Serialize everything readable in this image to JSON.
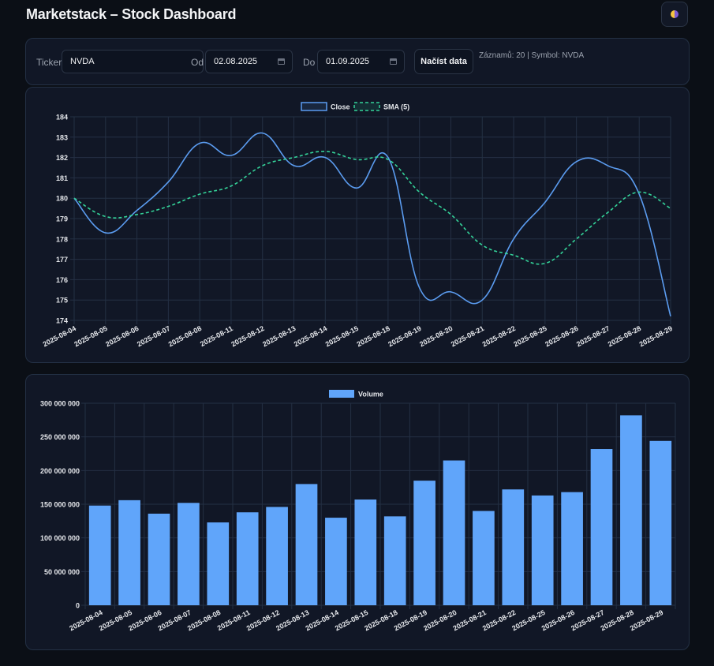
{
  "header": {
    "title": "Marketstack – Stock Dashboard",
    "theme_toggle_icon": "contrast-icon"
  },
  "controls": {
    "ticker_label": "Ticker",
    "ticker_value": "NVDA",
    "from_label": "Od",
    "from_value": "02.08.2025",
    "to_label": "Do",
    "to_value": "01.09.2025",
    "load_button": "Načíst data",
    "status": "Záznamů: 20 | Symbol: NVDA"
  },
  "colors": {
    "close": "#5b9cf0",
    "sma": "#34d399",
    "volume": "#60a5fa",
    "grid": "#243044",
    "tick": "#e5e7eb"
  },
  "chart_data": [
    {
      "type": "line",
      "x": [
        "2025-08-04",
        "2025-08-05",
        "2025-08-06",
        "2025-08-07",
        "2025-08-08",
        "2025-08-11",
        "2025-08-12",
        "2025-08-13",
        "2025-08-14",
        "2025-08-15",
        "2025-08-18",
        "2025-08-19",
        "2025-08-20",
        "2025-08-21",
        "2025-08-22",
        "2025-08-25",
        "2025-08-26",
        "2025-08-27",
        "2025-08-28",
        "2025-08-29"
      ],
      "series": [
        {
          "name": "Close",
          "style": "solid",
          "values": [
            180.0,
            178.3,
            179.4,
            180.8,
            182.7,
            182.1,
            183.2,
            181.6,
            182.0,
            180.5,
            182.0,
            175.6,
            175.4,
            175.0,
            178.0,
            179.8,
            181.8,
            181.6,
            180.2,
            174.2
          ]
        },
        {
          "name": "SMA (5)",
          "style": "dashed",
          "values": [
            180.0,
            179.1,
            179.2,
            179.6,
            180.2,
            180.6,
            181.6,
            182.0,
            182.3,
            181.9,
            181.9,
            180.3,
            179.2,
            177.7,
            177.2,
            176.8,
            178.0,
            179.3,
            180.3,
            179.5
          ]
        }
      ],
      "ylim": [
        174,
        184
      ],
      "yticks": [
        "174",
        "175",
        "176",
        "177",
        "178",
        "179",
        "180",
        "181",
        "182",
        "183",
        "184"
      ],
      "grid": true,
      "legend": "top-center"
    },
    {
      "type": "bar",
      "categories": [
        "2025-08-04",
        "2025-08-05",
        "2025-08-06",
        "2025-08-07",
        "2025-08-08",
        "2025-08-11",
        "2025-08-12",
        "2025-08-13",
        "2025-08-14",
        "2025-08-15",
        "2025-08-18",
        "2025-08-19",
        "2025-08-20",
        "2025-08-21",
        "2025-08-22",
        "2025-08-25",
        "2025-08-26",
        "2025-08-27",
        "2025-08-28",
        "2025-08-29"
      ],
      "series": [
        {
          "name": "Volume",
          "values": [
            148000000,
            156000000,
            136000000,
            152000000,
            123000000,
            138000000,
            146000000,
            180000000,
            130000000,
            157000000,
            132000000,
            185000000,
            215000000,
            140000000,
            172000000,
            163000000,
            168000000,
            232000000,
            282000000,
            244000000
          ]
        }
      ],
      "ylim": [
        0,
        300000000
      ],
      "yticks": [
        "0",
        "50 000 000",
        "100 000 000",
        "150 000 000",
        "200 000 000",
        "250 000 000",
        "300 000 000"
      ],
      "grid": true,
      "legend": "top-center"
    }
  ]
}
